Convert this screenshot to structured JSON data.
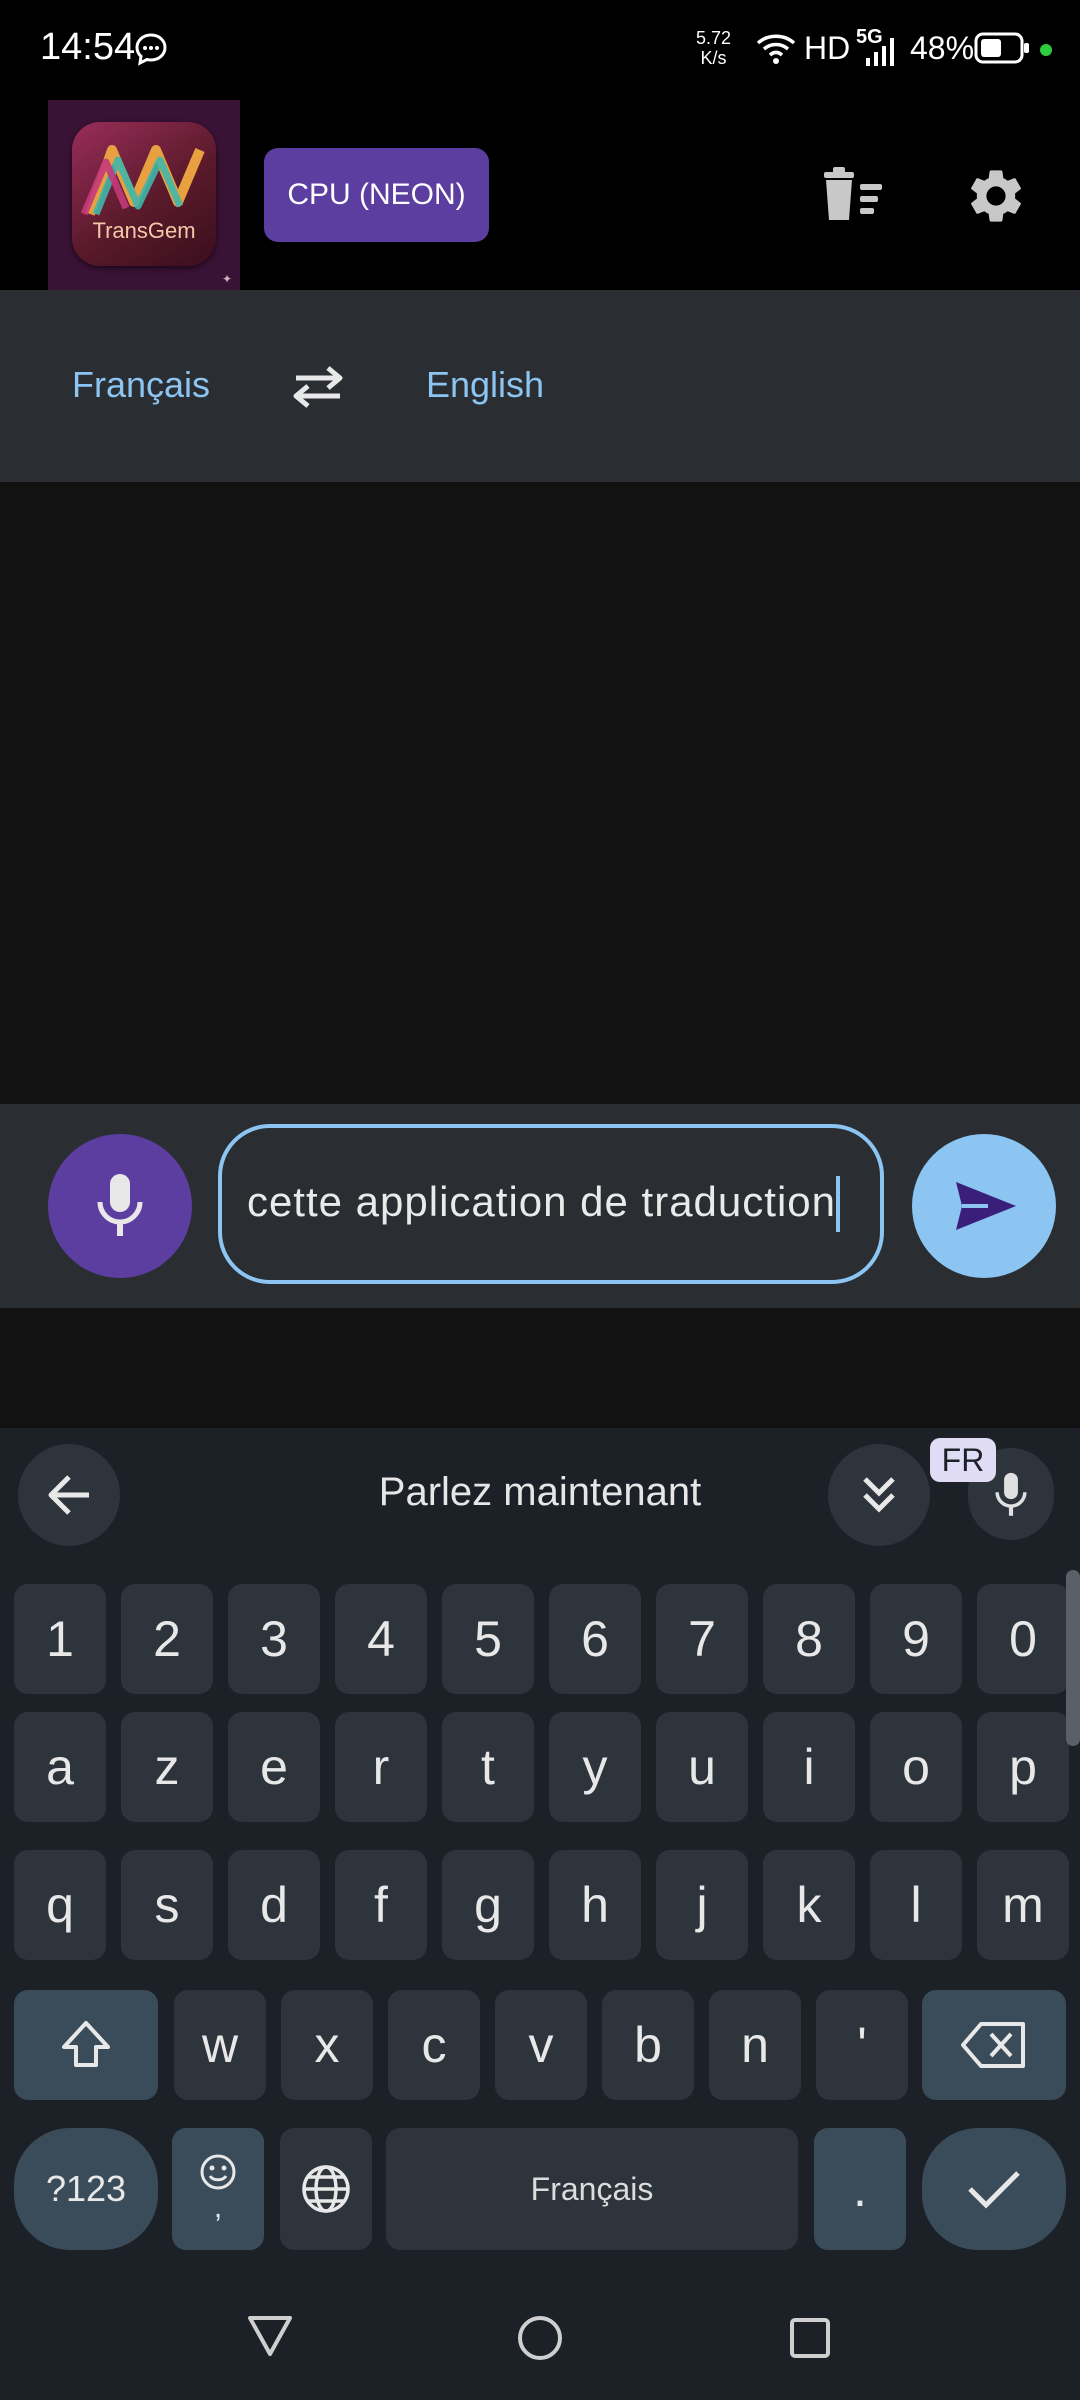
{
  "status_bar": {
    "time": "14:54",
    "net_speed_value": "5.72",
    "net_speed_unit": "K/s",
    "network": "HD",
    "signal": "5G",
    "battery": "48%"
  },
  "app_bar": {
    "logo_text": "TransGem",
    "backend_label": "CPU (NEON)"
  },
  "languages": {
    "source": "Français",
    "target": "English"
  },
  "input": {
    "value": "cette application de traduction"
  },
  "keyboard": {
    "voice_prompt": "Parlez maintenant",
    "voice_lang_badge": "FR",
    "space_label": "Français",
    "symbols_label": "?123",
    "row_numbers": [
      "1",
      "2",
      "3",
      "4",
      "5",
      "6",
      "7",
      "8",
      "9",
      "0"
    ],
    "row_1": [
      "a",
      "z",
      "e",
      "r",
      "t",
      "y",
      "u",
      "i",
      "o",
      "p"
    ],
    "row_2": [
      "q",
      "s",
      "d",
      "f",
      "g",
      "h",
      "j",
      "k",
      "l",
      "m"
    ],
    "row_3": [
      "w",
      "x",
      "c",
      "v",
      "b",
      "n",
      "'"
    ],
    "emoji_sub": ",",
    "period": "."
  },
  "icons": {
    "status_message": "message-bubble-icon",
    "wifi": "wifi-icon",
    "battery": "battery-icon",
    "delete": "delete-all-icon",
    "settings": "gear-icon",
    "swap": "swap-languages-icon",
    "mic": "microphone-icon",
    "send": "send-icon"
  },
  "colors": {
    "accent_purple": "#5b3ea0",
    "accent_blue": "#8cc4f2",
    "surface": "#2a2e32"
  }
}
